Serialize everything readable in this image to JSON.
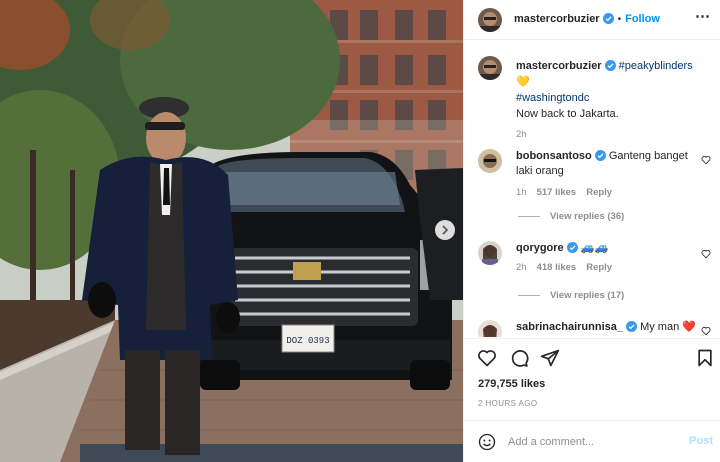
{
  "post": {
    "author": "mastercorbuzier",
    "follow_label": "Follow",
    "dot": "•",
    "plate_text": "DOZ 0393"
  },
  "caption": {
    "username": "mastercorbuzier",
    "hashtag1": "#peakyblinders",
    "emoji": "💛",
    "hashtag2": "#washingtondc",
    "text": "Now back to Jakarta.",
    "time": "2h"
  },
  "comments": [
    {
      "username": "bobonsantoso",
      "text": "Ganteng banget laki orang",
      "time": "1h",
      "likes": "517 likes",
      "reply": "Reply",
      "view_replies": "View replies (36)"
    },
    {
      "username": "qorygore",
      "text": "🚙🚙",
      "time": "2h",
      "likes": "418 likes",
      "reply": "Reply",
      "view_replies": "View replies (17)"
    },
    {
      "username": "sabrinachairunnisa_",
      "text": "My man ❤️"
    }
  ],
  "stats": {
    "likes": "279,755 likes",
    "time_ago": "2 HOURS AGO"
  },
  "add_comment": {
    "placeholder": "Add a comment...",
    "post_label": "Post"
  },
  "icons": {
    "verified": "verified-badge-icon",
    "like": "heart-icon",
    "comment": "comment-bubble-icon",
    "share": "paper-plane-icon",
    "save": "bookmark-icon",
    "emoji": "smiley-icon",
    "more": "more-options-icon",
    "next": "chevron-right-icon"
  },
  "colors": {
    "link_blue": "#0095f6",
    "hashtag_blue": "#00376b",
    "muted_gray": "#8e8e8e",
    "post_disabled": "#b2dffc"
  }
}
